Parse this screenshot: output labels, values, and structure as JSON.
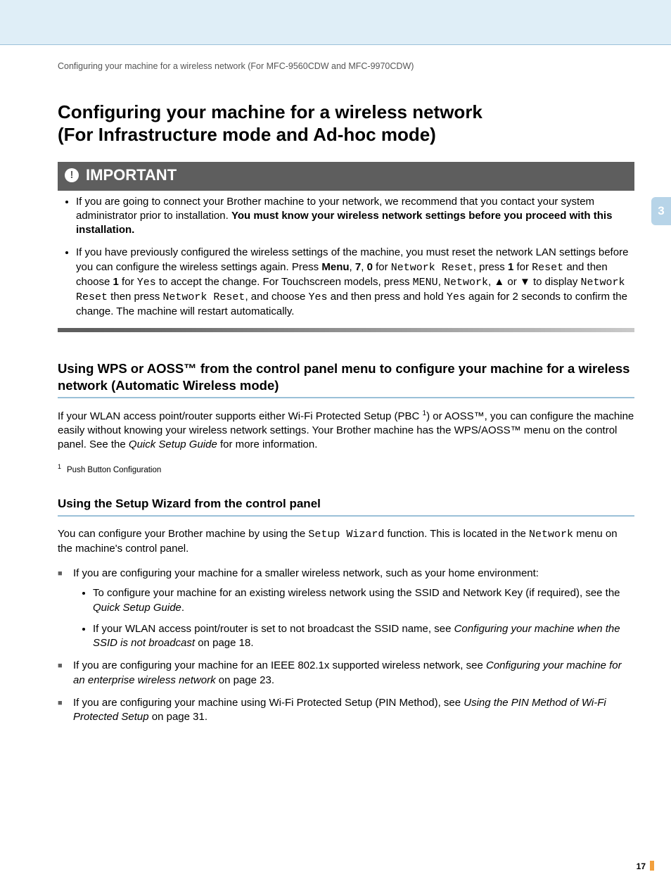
{
  "sidetab": "3",
  "breadcrumb": "Configuring your machine for a wireless network (For MFC-9560CDW and MFC-9970CDW)",
  "h1_line1": "Configuring your machine for a wireless network",
  "h1_line2": "(For Infrastructure mode and Ad-hoc mode)",
  "important_label": "IMPORTANT",
  "imp_b1_a": "If you are going to connect your Brother machine to your network, we recommend that you contact your system administrator prior to installation. ",
  "imp_b1_b": "You must know your wireless network settings before you proceed with this installation.",
  "imp_b2_a": "If you have previously configured the wireless settings of the machine, you must reset the network LAN settings before you can configure the wireless settings again. Press ",
  "imp_b2_menu": "Menu",
  "imp_b2_c": ", ",
  "imp_b2_7": "7",
  "imp_b2_e": ", ",
  "imp_b2_0": "0",
  "imp_b2_g": " for ",
  "imp_b2_nr": "Network Reset",
  "imp_b2_i": ", press ",
  "imp_b2_1": "1",
  "imp_b2_k": " for ",
  "imp_b2_reset": "Reset",
  "imp_b2_m": " and then choose ",
  "imp_b2_1b": "1",
  "imp_b2_o": " for ",
  "imp_b2_yes": "Yes",
  "imp_b2_q": " to accept the change. For Touchscreen models, press ",
  "imp_b2_MENU": "MENU",
  "imp_b2_s": ", ",
  "imp_b2_Network": "Network",
  "imp_b2_u": ", ",
  "imp_b2_up": "▲",
  "imp_b2_or": " or ",
  "imp_b2_dn": "▼",
  "imp_b2_w": " to display ",
  "imp_b2_nr2": "Network Reset",
  "imp_b2_y": " then press ",
  "imp_b2_nr3": "Network Reset",
  "imp_b2_aa": ", and choose ",
  "imp_b2_yes2": "Yes",
  "imp_b2_cc": " and then press and hold ",
  "imp_b2_yes3": "Yes",
  "imp_b2_ee": " again for 2 seconds to confirm the change. The machine will restart automatically.",
  "h2_wps": "Using WPS or AOSS™ from the control panel menu to configure your machine for a wireless network (Automatic Wireless mode)",
  "p_wps_a": "If your WLAN access point/router supports either Wi-Fi Protected Setup (PBC ",
  "p_wps_sup": "1",
  "p_wps_b": ") or AOSS™, you can configure the machine easily without knowing your wireless network settings. Your Brother machine has the WPS/AOSS™ menu on the control panel. See the ",
  "p_wps_em": "Quick Setup Guide",
  "p_wps_c": " for more information.",
  "fn_num": "1",
  "fn_text": "Push Button Configuration",
  "h3_wizard": "Using the Setup Wizard from the control panel",
  "p_wiz_a": "You can configure your Brother machine by using the ",
  "p_wiz_sw": "Setup Wizard",
  "p_wiz_b": " function. This is located in the ",
  "p_wiz_net": "Network",
  "p_wiz_c": " menu on the machine's control panel.",
  "sq1": "If you are configuring your machine for a smaller wireless network, such as your home environment:",
  "sq1_s1_a": "To configure your machine for an existing wireless network using the SSID and Network Key (if required), see the ",
  "sq1_s1_em": "Quick Setup Guide",
  "sq1_s1_b": ".",
  "sq1_s2_a": "If your WLAN access point/router is set to not broadcast the SSID name, see ",
  "sq1_s2_em": "Configuring your machine when the SSID is not broadcast",
  "sq1_s2_b": " on page 18.",
  "sq2_a": "If you are configuring your machine for an IEEE 802.1x supported wireless network, see ",
  "sq2_em": "Configuring your machine for an enterprise wireless network",
  "sq2_b": " on page 23.",
  "sq3_a": "If you are configuring your machine using Wi-Fi Protected Setup (PIN Method), see ",
  "sq3_em": "Using the PIN Method of Wi-Fi Protected Setup",
  "sq3_b": " on page 31.",
  "pagenum": "17"
}
